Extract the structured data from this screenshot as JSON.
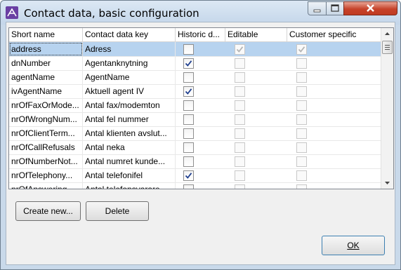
{
  "window": {
    "title": "Contact data, basic configuration",
    "icons": {
      "app": "app-logo-icon",
      "minimize": "minimize-icon",
      "maximize": "maximize-icon",
      "close": "close-icon"
    }
  },
  "table": {
    "headers": [
      "Short name",
      "Contact data key",
      "Historic d...",
      "Editable",
      "Customer specific"
    ],
    "rows": [
      {
        "short_name": "address",
        "key": "Adress",
        "historic": false,
        "editable": true,
        "customer_specific": true,
        "selected": true
      },
      {
        "short_name": "dnNumber",
        "key": "Agentanknytning",
        "historic": true,
        "editable": false,
        "customer_specific": false
      },
      {
        "short_name": "agentName",
        "key": "AgentName",
        "historic": false,
        "editable": false,
        "customer_specific": false
      },
      {
        "short_name": "ivAgentName",
        "key": "Aktuell agent IV",
        "historic": true,
        "editable": false,
        "customer_specific": false
      },
      {
        "short_name": "nrOfFaxOrMode...",
        "key": "Antal fax/modemton",
        "historic": false,
        "editable": false,
        "customer_specific": false
      },
      {
        "short_name": "nrOfWrongNum...",
        "key": "Antal fel nummer",
        "historic": false,
        "editable": false,
        "customer_specific": false
      },
      {
        "short_name": "nrOfClientTerm...",
        "key": "Antal klienten avslut...",
        "historic": false,
        "editable": false,
        "customer_specific": false
      },
      {
        "short_name": "nrOfCallRefusals",
        "key": "Antal neka",
        "historic": false,
        "editable": false,
        "customer_specific": false
      },
      {
        "short_name": "nrOfNumberNot...",
        "key": "Antal numret kunde...",
        "historic": false,
        "editable": false,
        "customer_specific": false
      },
      {
        "short_name": "nrOfTelephony...",
        "key": "Antal telefonifel",
        "historic": true,
        "editable": false,
        "customer_specific": false
      },
      {
        "short_name": "nrOfAnswering...",
        "key": "Antal telefonsvarare",
        "historic": false,
        "editable": false,
        "customer_specific": false
      }
    ]
  },
  "buttons": {
    "create_new": "Create new...",
    "delete": "Delete",
    "ok": "OK"
  },
  "colors": {
    "selection": "#b7d3ef",
    "check": "#1f3f8f"
  }
}
